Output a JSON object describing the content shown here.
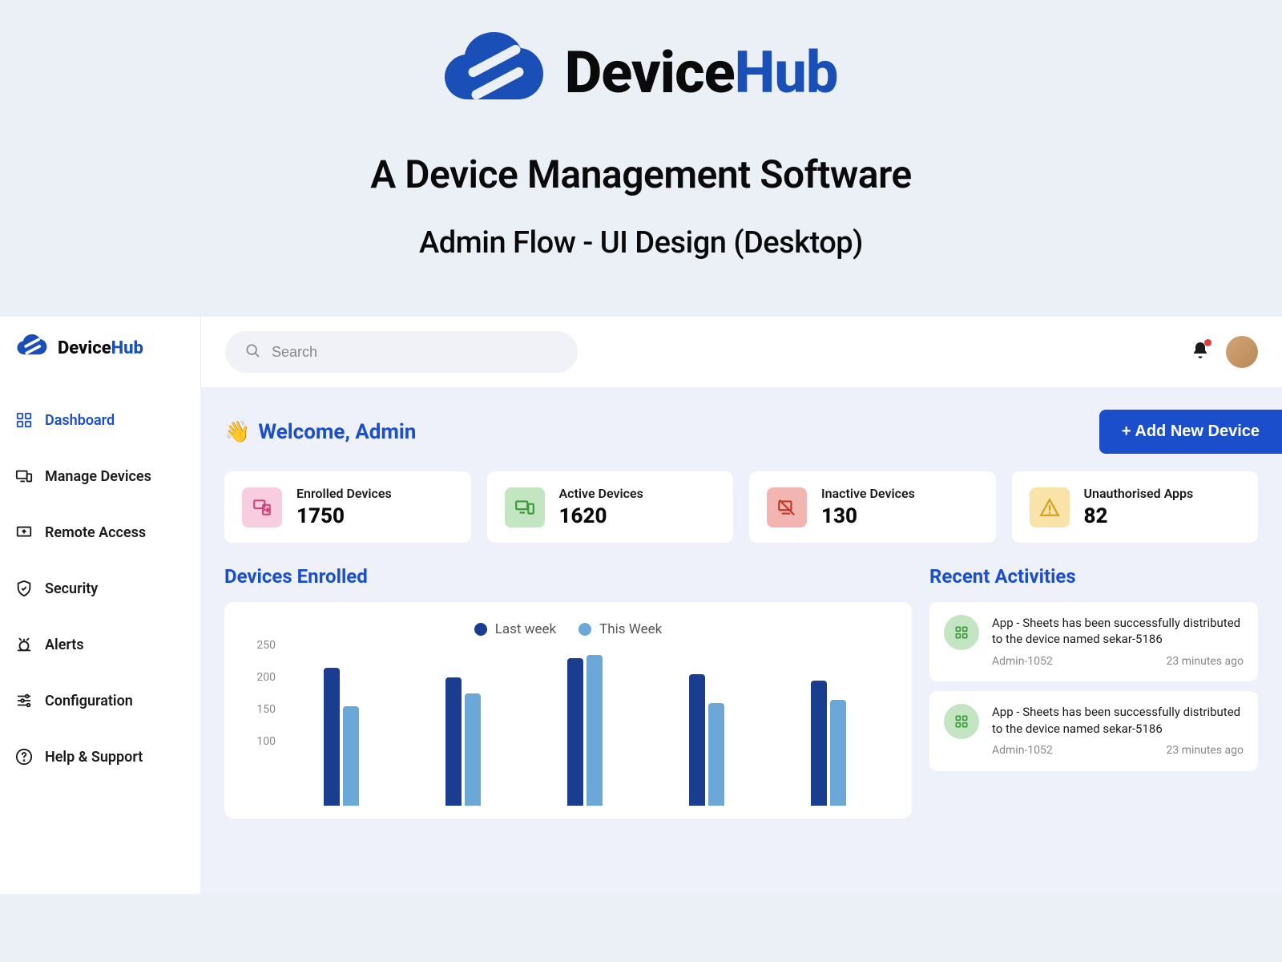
{
  "hero": {
    "brand_first": "Device",
    "brand_second": "Hub",
    "headline": "A Device Management Software",
    "subheadline": "Admin Flow - UI Design (Desktop)"
  },
  "header": {
    "brand_first": "Device",
    "brand_second": "Hub",
    "search_placeholder": "Search"
  },
  "sidebar": {
    "items": [
      {
        "label": "Dashboard"
      },
      {
        "label": "Manage Devices"
      },
      {
        "label": "Remote Access"
      },
      {
        "label": "Security"
      },
      {
        "label": "Alerts"
      },
      {
        "label": "Configuration"
      },
      {
        "label": "Help & Support"
      }
    ]
  },
  "welcome": {
    "emoji": "👋",
    "text": "Welcome, Admin"
  },
  "add_button": "+ Add New Device",
  "stats": [
    {
      "label": "Enrolled Devices",
      "value": "1750"
    },
    {
      "label": "Active Devices",
      "value": "1620"
    },
    {
      "label": "Inactive Devices",
      "value": "130"
    },
    {
      "label": "Unauthorised Apps",
      "value": "82"
    }
  ],
  "chart_section_title": "Devices Enrolled",
  "recent_section_title": "Recent Activities",
  "legend": {
    "last_week": "Last week",
    "this_week": "This Week"
  },
  "chart_data": {
    "type": "bar",
    "title": "Devices Enrolled",
    "xlabel": "",
    "ylabel": "",
    "ylim": [
      0,
      250
    ],
    "y_ticks": [
      250,
      200,
      150,
      100
    ],
    "categories": [
      "",
      "",
      "",
      "",
      ""
    ],
    "series": [
      {
        "name": "Last week",
        "values": [
          215,
          200,
          230,
          205,
          195
        ]
      },
      {
        "name": "This Week",
        "values": [
          155,
          175,
          235,
          160,
          165
        ]
      }
    ]
  },
  "activities": [
    {
      "text": "App - Sheets has been successfully distributed to the device named  sekar-5186",
      "author": "Admin-1052",
      "time": "23 minutes ago"
    },
    {
      "text": "App - Sheets has been successfully distributed to the device named  sekar-5186",
      "author": "Admin-1052",
      "time": "23 minutes ago"
    }
  ]
}
